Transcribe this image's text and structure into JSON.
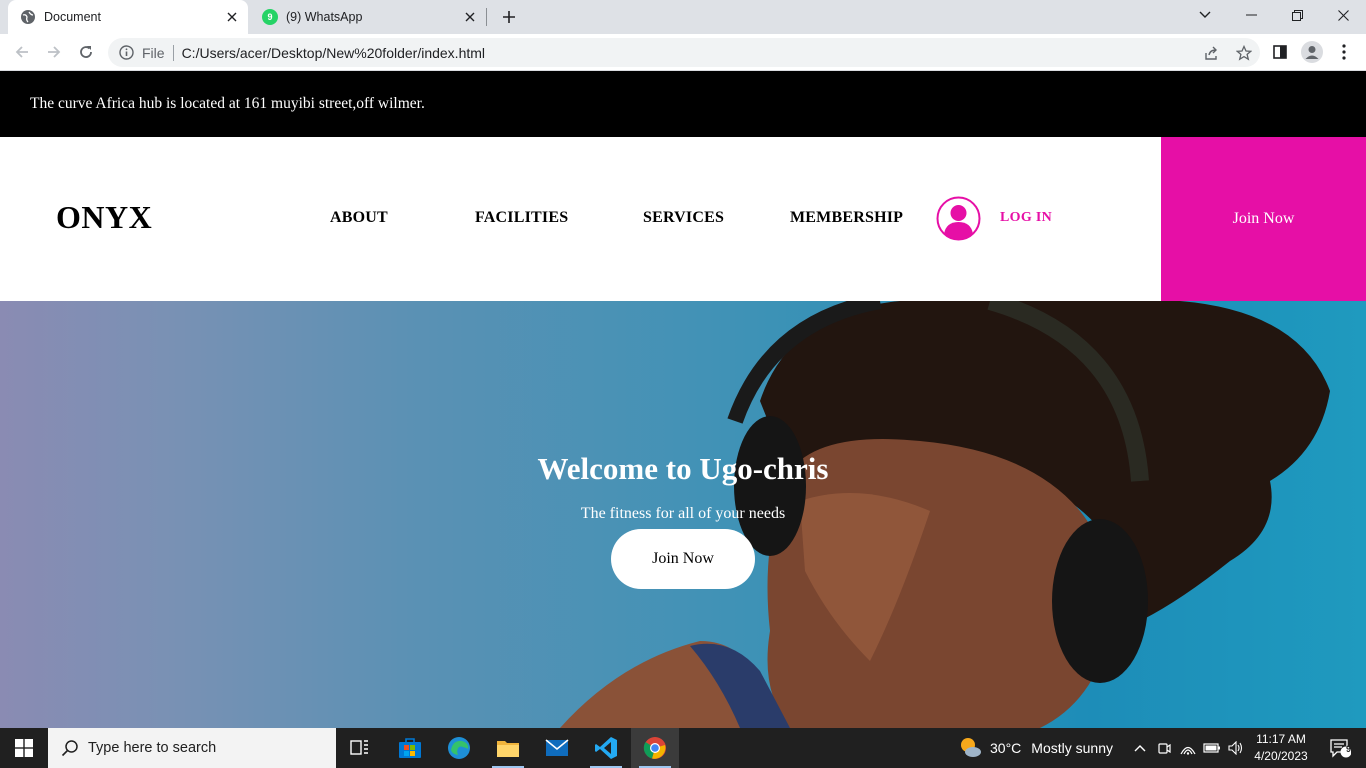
{
  "browser": {
    "tabs": [
      {
        "title": "Document",
        "active": true,
        "icon": "globe-icon"
      },
      {
        "title": "(9) WhatsApp",
        "active": false,
        "icon": "whatsapp-icon"
      }
    ],
    "address": {
      "scheme_label": "File",
      "url": "C:/Users/acer/Desktop/New%20folder/index.html"
    }
  },
  "page": {
    "announcement": "The curve Africa hub is located at 161 muyibi street,off wilmer.",
    "nav": {
      "logo": "ONYX",
      "links": [
        "ABOUT",
        "FACILITIES",
        "SERVICES",
        "MEMBERSHIP"
      ],
      "login_label": "LOG IN",
      "join_label": "Join Now"
    },
    "hero": {
      "title": "Welcome to Ugo-chris",
      "subtitle": "The fitness for all of your needs",
      "cta_label": "Join Now"
    },
    "colors": {
      "accent": "#e60fa6",
      "announcement_bg": "#000000"
    }
  },
  "taskbar": {
    "search_placeholder": "Type here to search",
    "weather": {
      "temp": "30°C",
      "desc": "Mostly sunny"
    },
    "clock": {
      "time": "11:17 AM",
      "date": "4/20/2023"
    },
    "notification_count": "9"
  }
}
